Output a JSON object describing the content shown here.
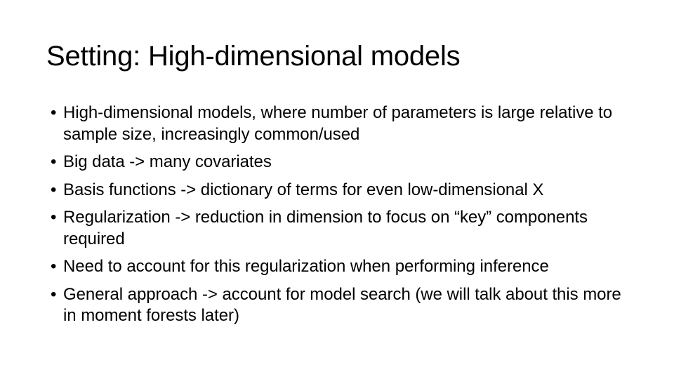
{
  "slide": {
    "title": "Setting: High-dimensional models",
    "bullet_marker": "•",
    "bullets": [
      {
        "text": "High-dimensional models, where number of parameters is large relative to sample size, increasingly common/used"
      },
      {
        "text": "Big data -> many covariates"
      },
      {
        "text": "Basis functions -> dictionary of terms for even low-dimensional X"
      },
      {
        "text": "Regularization -> reduction in dimension to focus on “key” components required"
      },
      {
        "text": "Need to account for this regularization when performing inference"
      },
      {
        "text": "General approach -> account for model search (we will talk about this more in moment forests later)"
      }
    ]
  }
}
